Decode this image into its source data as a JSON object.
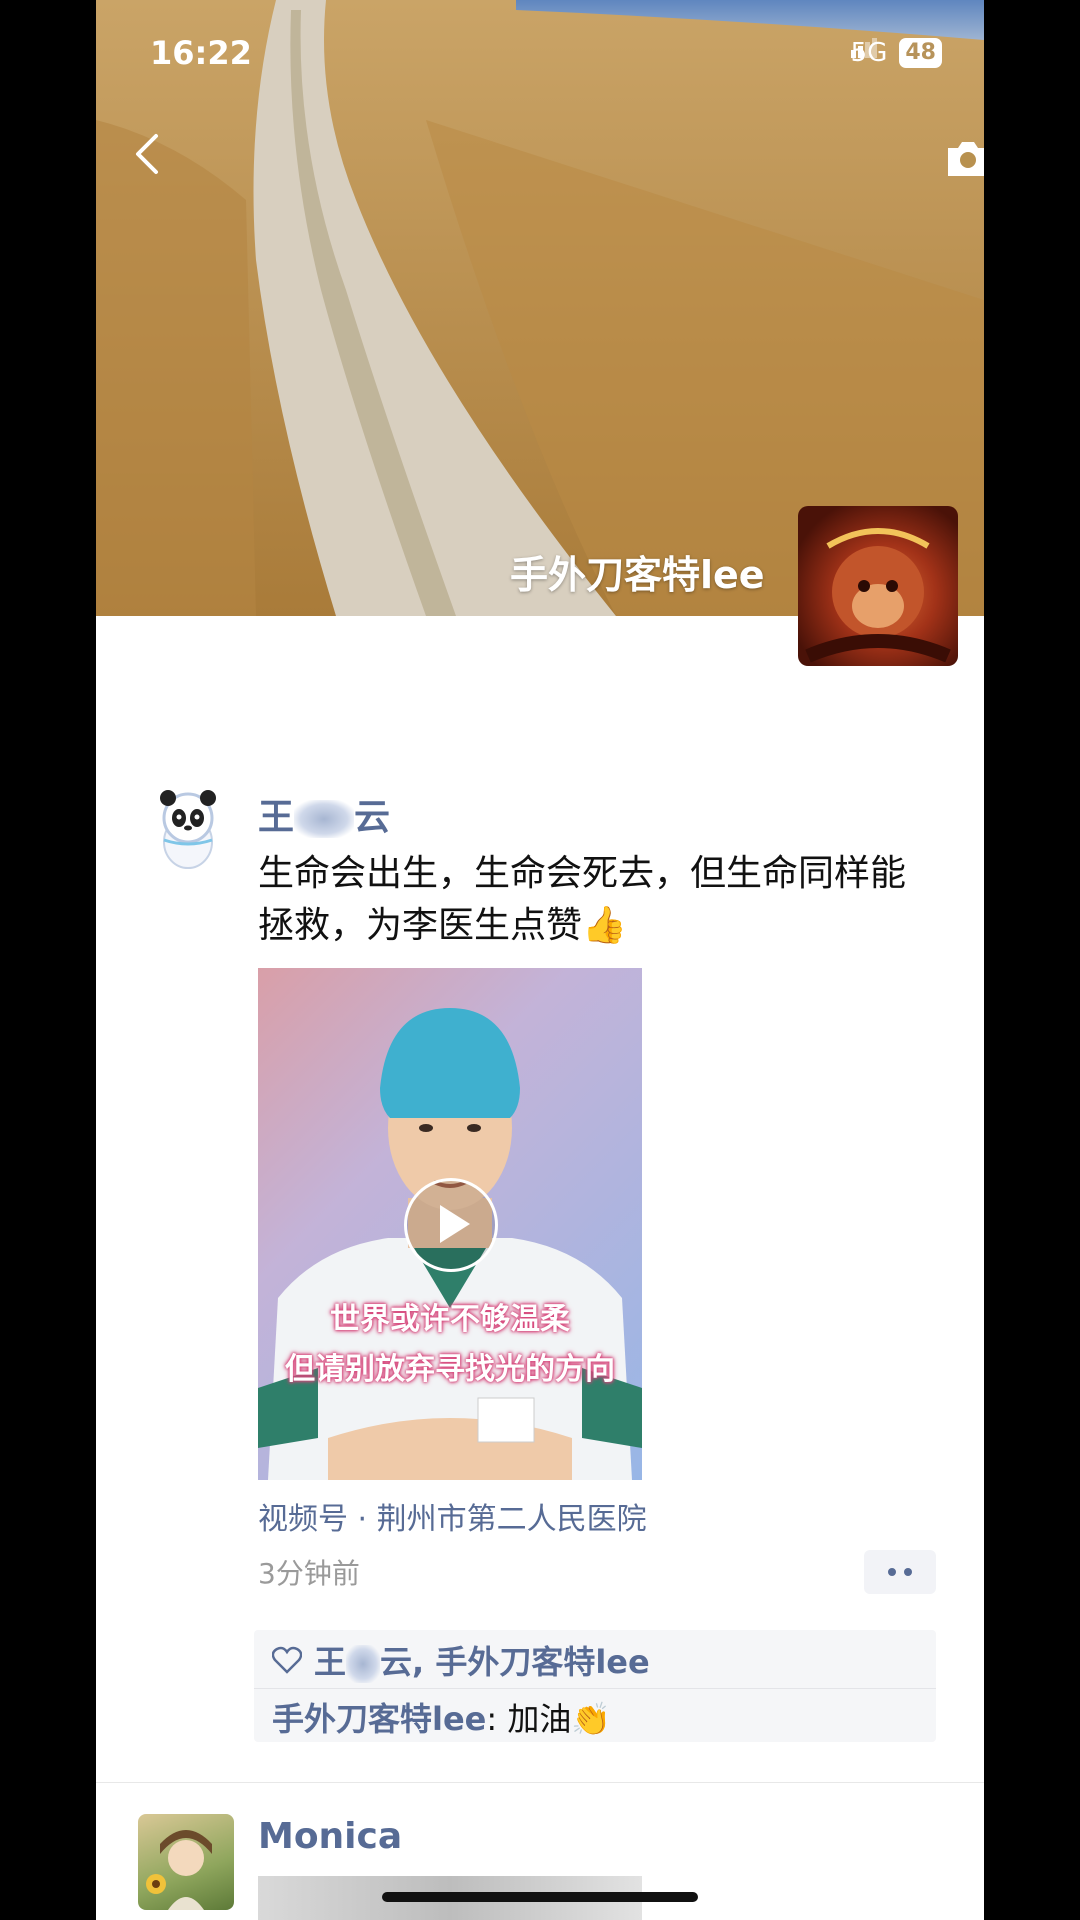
{
  "status_bar": {
    "time": "16:22",
    "network": "5G",
    "battery": "48"
  },
  "cover": {
    "owner_name": "手外刀客特lee"
  },
  "post": {
    "author": {
      "prefix": "王",
      "suffix": "云"
    },
    "text": "生命会出生，生命会死去，但生命同样能拯救，为李医生点赞👍",
    "video": {
      "caption_line1": "世界或许不够温柔",
      "caption_line2": "但请别放弃寻找光的方向"
    },
    "source": "视频号 · 荆州市第二人民医院",
    "time_ago": "3分钟前",
    "likes": {
      "names_1": "王",
      "names_2": "云, 手外刀客特lee"
    },
    "comment": {
      "author": "手外刀客特lee",
      "separator": ": ",
      "text": "加油👏"
    }
  },
  "next_post": {
    "author": "Monica"
  },
  "colors": {
    "link": "#576b95",
    "text": "#111111",
    "muted": "#9a9a9a"
  },
  "icons": [
    "back-icon",
    "camera-icon",
    "signal-icon",
    "play-icon",
    "heart-icon",
    "more-dots-icon"
  ]
}
